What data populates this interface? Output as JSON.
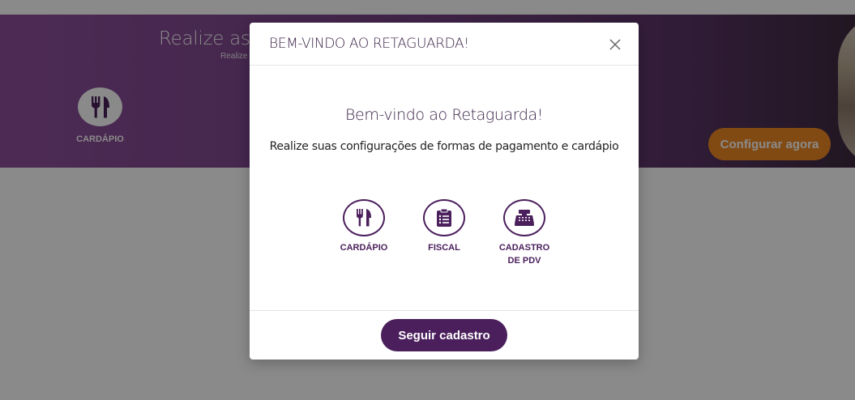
{
  "background": {
    "banner_title": "Realize as co",
    "banner_subtitle": "Realize",
    "cardapio_label": "CARDÁPIO",
    "config_button": "Configurar agora"
  },
  "modal": {
    "title": "BEM-VINDO AO RETAGUARDA!",
    "heading": "Bem-vindo ao Retaguarda!",
    "description": "Realize suas configurações de formas de pagamento e cardápio",
    "features": [
      {
        "label": "CARDÁPIO",
        "icon": "fork-knife-icon"
      },
      {
        "label": "FISCAL",
        "icon": "clipboard-list-icon"
      },
      {
        "label": "CADASTRO\nDE PDV",
        "icon": "cash-register-icon"
      }
    ],
    "primary_button": "Seguir cadastro"
  },
  "colors": {
    "brand_purple": "#4a1f5c",
    "banner_purple": "#8e4f9c",
    "accent_orange": "#f08a24"
  }
}
